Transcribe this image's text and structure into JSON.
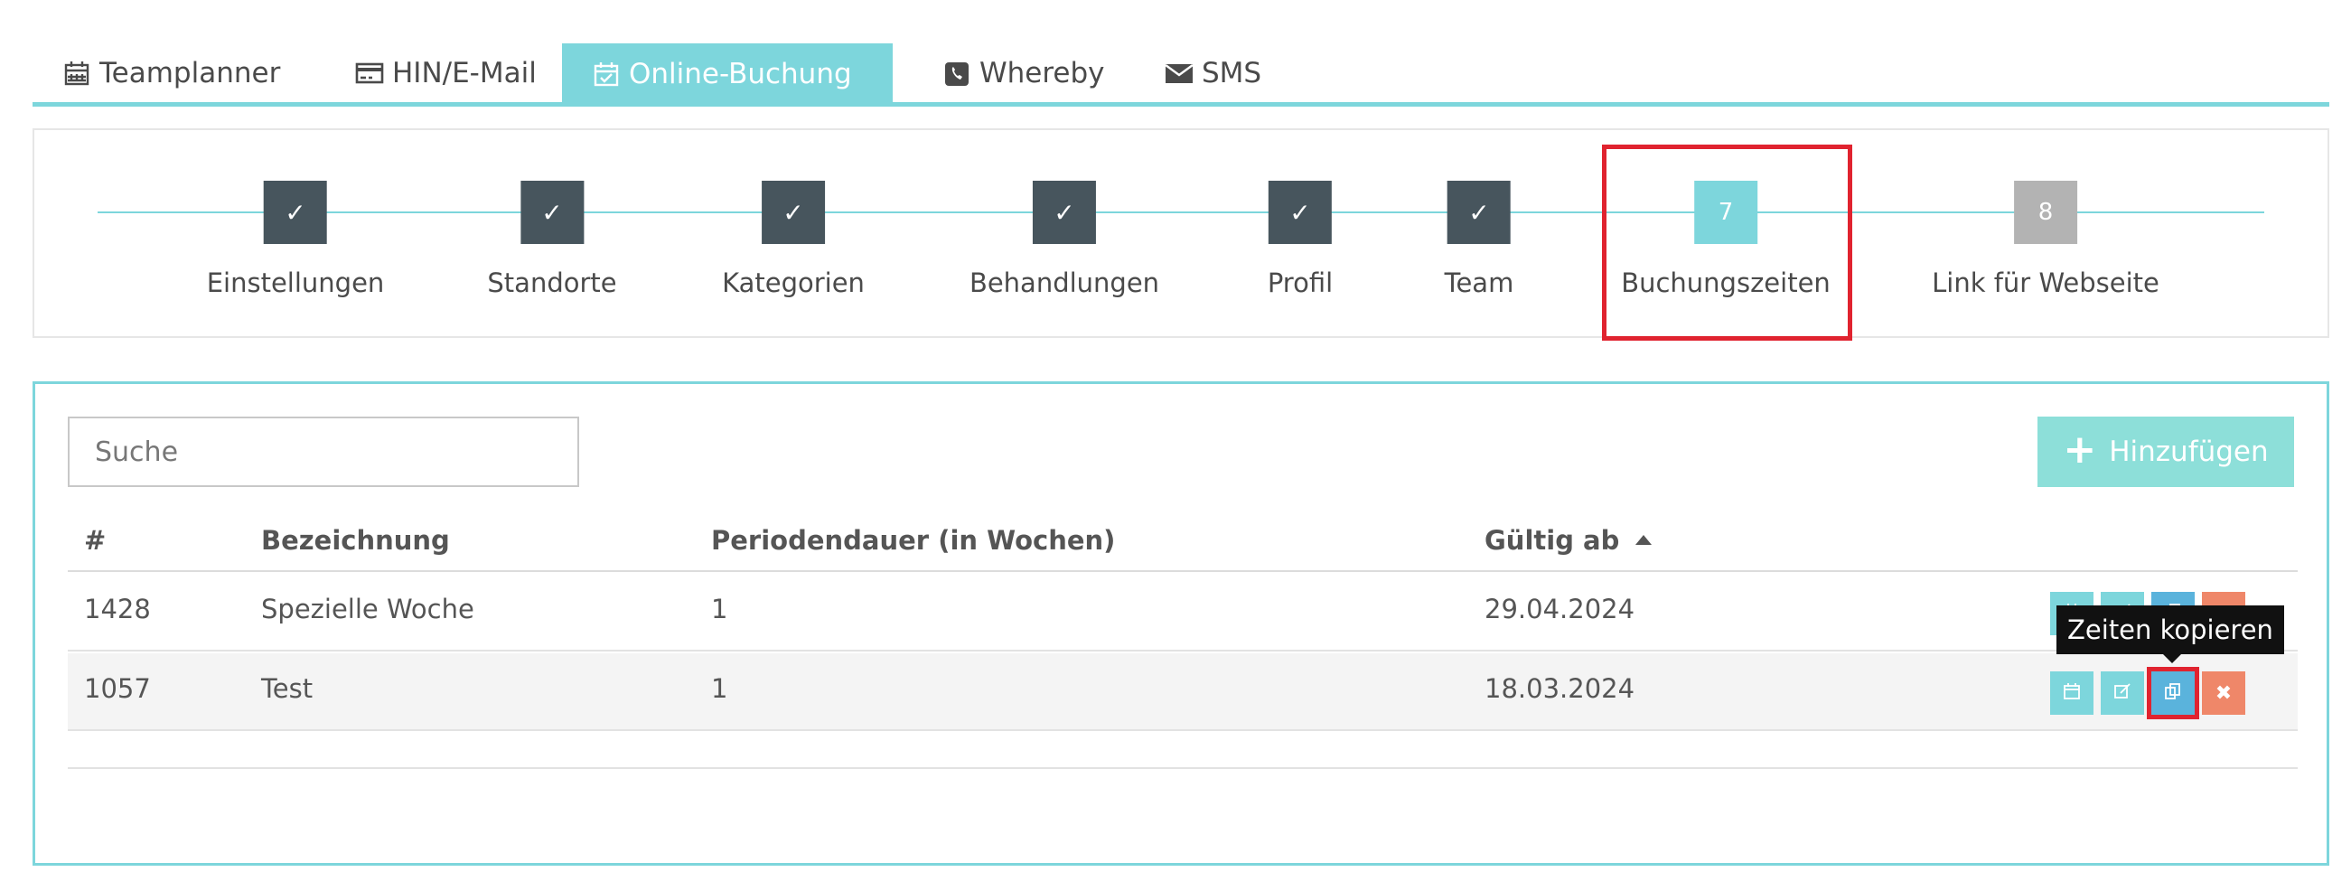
{
  "tabs": [
    {
      "label": "Teamplanner",
      "icon": "calendar-icon",
      "active": false
    },
    {
      "label": "HIN/E-Mail",
      "icon": "credit-card-icon",
      "active": false
    },
    {
      "label": "Online-Buchung",
      "icon": "calendar-check-icon",
      "active": true
    },
    {
      "label": "Whereby",
      "icon": "phone-icon",
      "active": false
    },
    {
      "label": "SMS",
      "icon": "envelope-icon",
      "active": false
    }
  ],
  "wizard": {
    "steps": [
      {
        "marker": "✓",
        "label": "Einstellungen",
        "state": "done"
      },
      {
        "marker": "✓",
        "label": "Standorte",
        "state": "done"
      },
      {
        "marker": "✓",
        "label": "Kategorien",
        "state": "done"
      },
      {
        "marker": "✓",
        "label": "Behandlungen",
        "state": "done"
      },
      {
        "marker": "✓",
        "label": "Profil",
        "state": "done"
      },
      {
        "marker": "✓",
        "label": "Team",
        "state": "done"
      },
      {
        "marker": "7",
        "label": "Buchungszeiten",
        "state": "current"
      },
      {
        "marker": "8",
        "label": "Link für Webseite",
        "state": "todo"
      }
    ]
  },
  "search": {
    "placeholder": "Suche",
    "value": ""
  },
  "add_button": {
    "label": "Hinzufügen",
    "icon": "plus-icon"
  },
  "table": {
    "columns": [
      "#",
      "Bezeichnung",
      "Periodendauer (in Wochen)",
      "Gültig ab"
    ],
    "sorted_column": "Gültig ab",
    "sort_direction": "ascending",
    "rows": [
      {
        "id": "1428",
        "name": "Spezielle Woche",
        "period": "1",
        "valid_from": "29.04.2024"
      },
      {
        "id": "1057",
        "name": "Test",
        "period": "1",
        "valid_from": "18.03.2024"
      }
    ],
    "row_actions": [
      "calendar-icon",
      "edit-icon",
      "copy-icon",
      "delete-icon"
    ]
  },
  "tooltip": {
    "text": "Zeiten kopieren"
  },
  "colors": {
    "accent": "#7dd6dc",
    "step_done": "#47555d",
    "step_todo": "#b3b3b3",
    "add_button": "#8ddfd9",
    "copy_button": "#5ab3dc",
    "delete_button": "#ef8769",
    "annotation_red": "#e0232f"
  }
}
